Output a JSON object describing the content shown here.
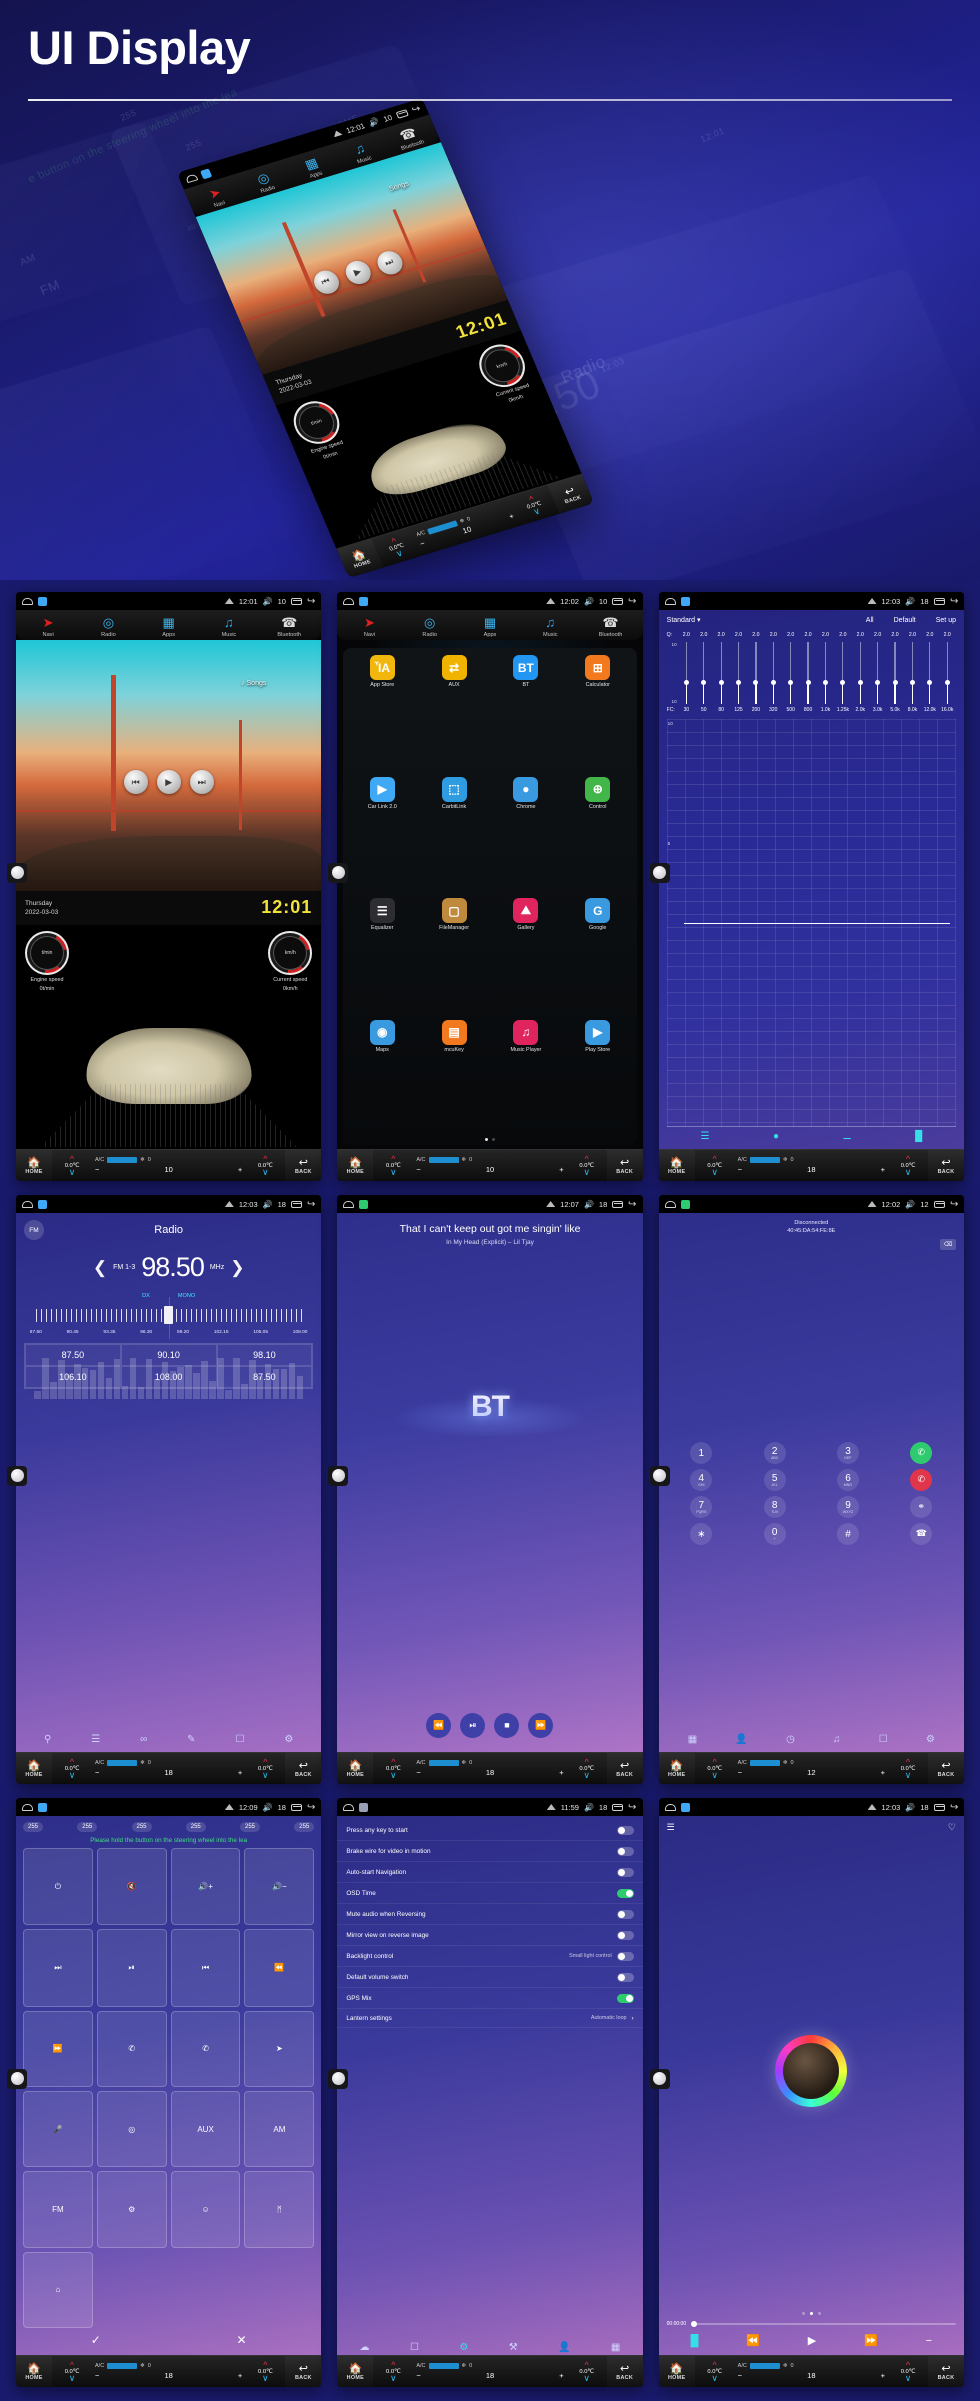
{
  "hero": {
    "title": "UI Display"
  },
  "statusbar_icons": {
    "home": "home-outline-icon",
    "app": "mini-app-icon",
    "signal": "signal-icon",
    "volume": "volume-icon",
    "recents": "recents-icon",
    "back": "back-icon"
  },
  "climate": {
    "home_label": "HOME",
    "back_label": "BACK",
    "left_temp": "0.0℃",
    "right_temp": "0.0℃",
    "ac_label": "A/C",
    "fan_value": "0",
    "level": "10",
    "minus": "−",
    "plus": "+"
  },
  "nav_strip": {
    "items": [
      {
        "label": "Navi",
        "icon": "navigation-arrow-icon"
      },
      {
        "label": "Radio",
        "icon": "radio-icon"
      },
      {
        "label": "Apps",
        "icon": "apps-grid-icon"
      },
      {
        "label": "Music",
        "icon": "music-note-icon"
      },
      {
        "label": "Bluetooth",
        "icon": "phone-handset-icon"
      }
    ]
  },
  "screens": [
    {
      "id": "home",
      "status": {
        "time": "12:01",
        "volume": "10"
      },
      "media": {
        "tag": "Songs",
        "prev": "⏮",
        "play": "▶",
        "next": "⏭"
      },
      "clock": {
        "weekday": "Thursday",
        "date": "2022-03-03",
        "time": "12:01"
      },
      "gauges": [
        {
          "unit": "t/min",
          "label": "Engine speed",
          "value": "0t/min"
        },
        {
          "unit": "km/h",
          "label": "Current speed",
          "value": "0km/h"
        }
      ],
      "climate_level": "10"
    },
    {
      "id": "apps",
      "status": {
        "time": "12:02",
        "volume": "10"
      },
      "apps": [
        {
          "label": "App Store",
          "glyph": "ἾA",
          "color": "#f2b70d",
          "icon": "store-icon"
        },
        {
          "label": "AUX",
          "glyph": "⇄",
          "color": "#f0b400",
          "icon": "aux-icon"
        },
        {
          "label": "BT",
          "glyph": "BT",
          "color": "#2196f3",
          "icon": "bluetooth-icon"
        },
        {
          "label": "Calculator",
          "glyph": "⊞",
          "color": "#f2791d",
          "icon": "calculator-icon"
        },
        {
          "label": "Car Link 2.0",
          "glyph": "▶",
          "color": "#3fa9f5",
          "icon": "carlink-icon"
        },
        {
          "label": "CarbitLink",
          "glyph": "⬚",
          "color": "#2f9be0",
          "icon": "carbitlink-icon"
        },
        {
          "label": "Chrome",
          "glyph": "●",
          "color": "#3a9ae0",
          "icon": "chrome-icon"
        },
        {
          "label": "Control",
          "glyph": "⊕",
          "color": "#43b649",
          "icon": "steering-wheel-icon"
        },
        {
          "label": "Equalizer",
          "glyph": "☰",
          "color": "#2e2e32",
          "icon": "equalizer-icon"
        },
        {
          "label": "FileManager",
          "glyph": "▢",
          "color": "#c08a3e",
          "icon": "folder-icon"
        },
        {
          "label": "Gallery",
          "glyph": "⛰",
          "color": "#e0245e",
          "icon": "gallery-icon"
        },
        {
          "label": "Google",
          "glyph": "G",
          "color": "#3a9ae0",
          "icon": "google-icon"
        },
        {
          "label": "Maps",
          "glyph": "◉",
          "color": "#3a9ae0",
          "icon": "maps-pin-icon"
        },
        {
          "label": "mcuKey",
          "glyph": "▤",
          "color": "#f2791d",
          "icon": "mcukey-icon"
        },
        {
          "label": "Music Player",
          "glyph": "♫",
          "color": "#e0245e",
          "icon": "music-player-icon"
        },
        {
          "label": "Play Store",
          "glyph": "▶",
          "color": "#3a9ae0",
          "icon": "play-store-icon"
        }
      ],
      "page_dots": 2,
      "active_dot": 0,
      "climate_level": "10"
    },
    {
      "id": "equalizer",
      "status": {
        "time": "12:03",
        "volume": "18"
      },
      "preset": "Standard",
      "actions": [
        "All",
        "Default",
        "Set up"
      ],
      "q_label": "Q:",
      "q_values": [
        "2.0",
        "2.0",
        "2.0",
        "2.0",
        "2.0",
        "2.0",
        "2.0",
        "2.0",
        "2.0",
        "2.0",
        "2.0",
        "2.0",
        "2.0",
        "2.0",
        "2.0",
        "2.0"
      ],
      "fc_label": "FC:",
      "fc_values": [
        "30",
        "50",
        "80",
        "125",
        "200",
        "320",
        "500",
        "800",
        "1.0k",
        "1.25k",
        "2.0k",
        "3.0k",
        "5.0k",
        "8.0k",
        "12.0k",
        "16.0k"
      ],
      "scale_top": "10",
      "scale_bottom": "10",
      "curve_y": [
        "10",
        "5"
      ],
      "tools": [
        "eq-wave-icon",
        "car-audio-icon",
        "speaker-balance-icon",
        "levels-icon"
      ],
      "climate_level": "18"
    },
    {
      "id": "radio",
      "status": {
        "time": "12:03",
        "volume": "18"
      },
      "band": "FM",
      "title": "Radio",
      "band_index": "FM 1-3",
      "frequency": "98.50",
      "unit": "MHz",
      "mode_labels": [
        "DX",
        "MONO"
      ],
      "scale": [
        "87.50",
        "90.45",
        "93.35",
        "96.30",
        "99.20",
        "102.15",
        "105.05",
        "108.00"
      ],
      "presets": [
        "87.50",
        "90.10",
        "98.10",
        "106.10",
        "108.00",
        "87.50"
      ],
      "tools": [
        "search-icon",
        "band-icon",
        "loop-icon",
        "edit-icon",
        "save-icon",
        "settings-icon"
      ],
      "climate_level": "18"
    },
    {
      "id": "bt-music",
      "status": {
        "time": "12:07",
        "volume": "18"
      },
      "now_playing_line": "That I can't keep out got me singin' like",
      "track": "In My Head (Explicit) – Lil Tjay",
      "logo": "BT",
      "controls": [
        "⏪",
        "⏯",
        "■",
        "⏩"
      ],
      "climate_level": "18"
    },
    {
      "id": "dialer",
      "status": {
        "time": "12:02",
        "volume": "12"
      },
      "connection_status": "Disconnected",
      "mac_address": "40:45:DA:54:FE:8E",
      "keys": [
        {
          "n": "1",
          "s": ""
        },
        {
          "n": "2",
          "s": "ABC"
        },
        {
          "n": "3",
          "s": "DEF"
        },
        {
          "n": "4",
          "s": "GHI"
        },
        {
          "n": "5",
          "s": "JKL"
        },
        {
          "n": "6",
          "s": "MNO"
        },
        {
          "n": "7",
          "s": "PQRS"
        },
        {
          "n": "8",
          "s": "TUV"
        },
        {
          "n": "9",
          "s": "WXYZ"
        },
        {
          "n": "∗",
          "s": ""
        },
        {
          "n": "0",
          "s": "+"
        },
        {
          "n": "#",
          "s": ""
        }
      ],
      "actions": [
        {
          "icon": "call-answer-icon",
          "color": "#2ecb6e",
          "glyph": "✆"
        },
        {
          "icon": "call-end-icon",
          "color": "#e0354a",
          "glyph": "✆"
        },
        {
          "icon": "link-icon",
          "color": "rgba(255,255,255,.12)",
          "glyph": "⚭"
        },
        {
          "icon": "contacts-sync-icon",
          "color": "rgba(255,255,255,.12)",
          "glyph": "☎"
        }
      ],
      "tools": [
        "apps-icon",
        "contacts-icon",
        "history-icon",
        "music-icon",
        "device-icon",
        "settings-icon"
      ],
      "climate_level": "12"
    },
    {
      "id": "steering-wheel-learn",
      "status": {
        "time": "12:09",
        "volume": "18"
      },
      "values": [
        "255",
        "255",
        "255",
        "255",
        "255",
        "255"
      ],
      "hint": "Please hold the button on the steering wheel into the lea",
      "buttons": [
        "power-icon",
        "mute-icon",
        "volume-up-icon",
        "volume-down-icon",
        "next-track-icon",
        "play-pause-icon",
        "prev-track-icon",
        "rewind-icon",
        "forward-icon",
        "call-icon",
        "hangup-icon",
        "seek-icon",
        "mic-icon",
        "mode-icon",
        "AUX",
        "AM",
        "FM",
        "settings-icon",
        "mood-icon",
        "bluetooth-icon",
        "home-icon"
      ],
      "confirm": "✓",
      "cancel": "✕",
      "climate_level": "18"
    },
    {
      "id": "settings",
      "status": {
        "time": "11:59",
        "volume": "18"
      },
      "rows": [
        {
          "label": "Press any key to start",
          "value": "",
          "toggle": "off"
        },
        {
          "label": "Brake wire for video in motion",
          "value": "",
          "toggle": "off"
        },
        {
          "label": "Auto-start Navigation",
          "value": "",
          "toggle": "off"
        },
        {
          "label": "OSD Time",
          "value": "",
          "toggle": "on"
        },
        {
          "label": "Mute audio when Reversing",
          "value": "",
          "toggle": "off"
        },
        {
          "label": "Mirror view on reverse image",
          "value": "",
          "toggle": "off"
        },
        {
          "label": "Backlight control",
          "value": "Small light control",
          "toggle": "off"
        },
        {
          "label": "Default volume switch",
          "value": "",
          "toggle": "off"
        },
        {
          "label": "GPS Mix",
          "value": "",
          "toggle": "on"
        },
        {
          "label": "Lantern settings",
          "value": "Automatic loop",
          "toggle": "chevron"
        }
      ],
      "tools": [
        "wifi-icon",
        "screen-icon",
        "settings-gear-icon",
        "tools-icon",
        "user-icon",
        "apps-icon"
      ],
      "climate_level": "18"
    },
    {
      "id": "video-player",
      "status": {
        "time": "12:03",
        "volume": "18"
      },
      "list_icon": "playlist-icon",
      "favorite_icon": "heart-icon",
      "time_elapsed": "00:00:00",
      "dots_count": 3,
      "active_dot": 1,
      "controls": [
        "levels-icon",
        "⏪",
        "▶",
        "⏩",
        "−"
      ],
      "climate_level": "18"
    }
  ]
}
